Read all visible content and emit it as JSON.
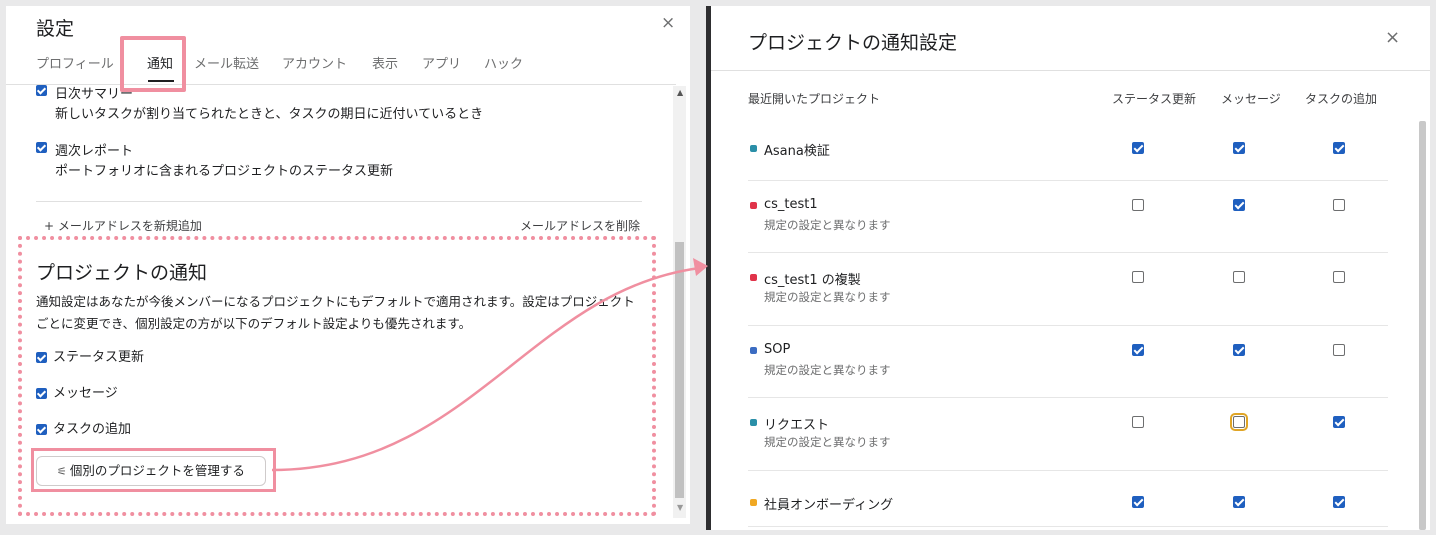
{
  "settings": {
    "title": "設定",
    "close_icon": "×",
    "tabs": [
      "プロフィール",
      "通知",
      "メール転送",
      "アカウント",
      "表示",
      "アプリ",
      "ハック"
    ],
    "active_tab": "通知",
    "email_items": [
      {
        "title": "日次サマリー",
        "desc": "新しいタスクが割り当てられたときと、タスクの期日に近付いているとき"
      },
      {
        "title": "週次レポート",
        "desc": "ポートフォリオに含まれるプロジェクトのステータス更新"
      }
    ],
    "add_email": "+ メールアドレスを新規追加",
    "delete_email": "メールアドレスを削除",
    "scroll_up": "▲",
    "scroll_down": "▼",
    "project_notifications": {
      "title": "プロジェクトの通知",
      "description": "通知設定はあなたが今後メンバーになるプロジェクトにもデフォルトで適用されます。設定はプロジェクトごとに変更でき、個別設定の方が以下のデフォルト設定よりも優先されます。",
      "options": [
        {
          "label": "ステータス更新",
          "checked": true
        },
        {
          "label": "メッセージ",
          "checked": true
        },
        {
          "label": "タスクの追加",
          "checked": true
        }
      ],
      "manage_button": "個別のプロジェクトを管理する",
      "manage_icon": "sliders-icon"
    }
  },
  "project_dialog": {
    "title": "プロジェクトの通知設定",
    "close_icon": "×",
    "columns": {
      "project": "最近開いたプロジェクト",
      "status": "ステータス更新",
      "message": "メッセージ",
      "task": "タスクの追加"
    },
    "rows": [
      {
        "name": "Asana検証",
        "sub": "",
        "color": "#2a8fa8",
        "status": true,
        "message": true,
        "task": true
      },
      {
        "name": "cs_test1",
        "sub": "規定の設定と異なります",
        "color": "#e0334a",
        "status": false,
        "message": true,
        "task": false
      },
      {
        "name": "cs_test1 の複製",
        "sub": "規定の設定と異なります",
        "color": "#e0334a",
        "status": false,
        "message": false,
        "task": false
      },
      {
        "name": "SOP",
        "sub": "規定の設定と異なります",
        "color": "#3b6cc2",
        "status": true,
        "message": true,
        "task": false
      },
      {
        "name": "リクエスト",
        "sub": "規定の設定と異なります",
        "color": "#2a8fa8",
        "status": false,
        "message": false,
        "task": true,
        "focus": "message"
      },
      {
        "name": "社員オンボーディング",
        "sub": "",
        "color": "#f0a823",
        "status": true,
        "message": true,
        "task": true
      }
    ]
  },
  "colors": {
    "accent": "#1f5fbf",
    "highlight": "#f08fa0"
  }
}
